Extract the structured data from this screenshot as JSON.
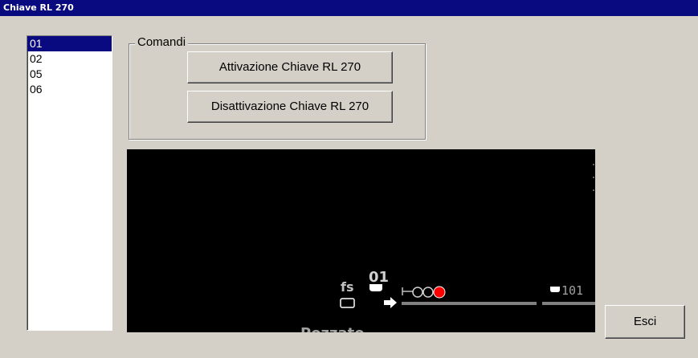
{
  "window": {
    "title": "Chiave RL 270"
  },
  "list": {
    "items": [
      "01",
      "02",
      "05",
      "06"
    ],
    "selected_index": 0
  },
  "commands": {
    "group_label": "Comandi",
    "activate_label": "Attivazione Chiave RL 270",
    "deactivate_label": "Disattivazione Chiave RL 270"
  },
  "diagram": {
    "fs_label": "fs",
    "signal_number": "01",
    "track_number": "101",
    "station_label": "Pozzato",
    "signal_lamp_color": "#ff0000",
    "track_color": "#808080"
  },
  "exit_label": "Esci"
}
